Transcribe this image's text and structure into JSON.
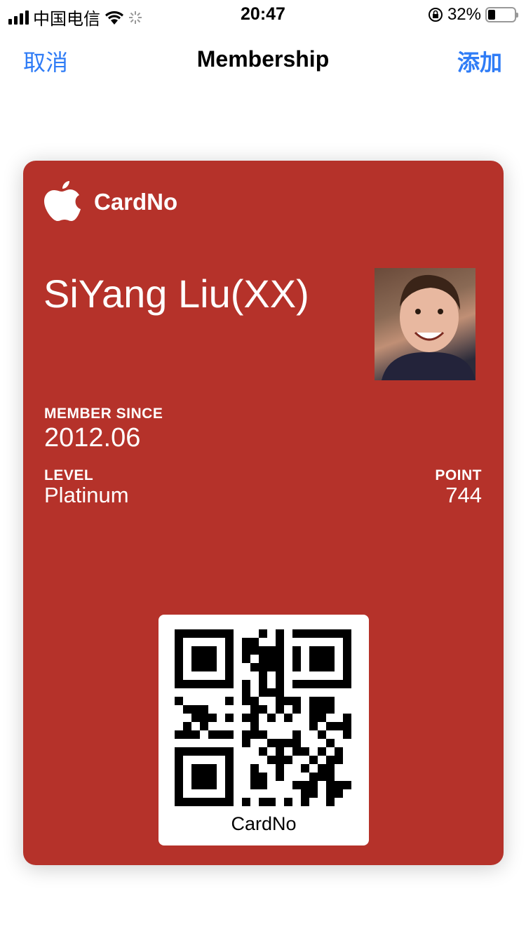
{
  "status_bar": {
    "carrier": "中国电信",
    "time": "20:47",
    "battery": "32%",
    "battery_level": 0.32
  },
  "nav": {
    "cancel": "取消",
    "title": "Membership",
    "add": "添加"
  },
  "card": {
    "brand": "CardNo",
    "name": "SiYang Liu(XX)",
    "member_since_label": "MEMBER SINCE",
    "member_since": "2012.06",
    "level_label": "LEVEL",
    "level": "Platinum",
    "point_label": "POINT",
    "point": "744",
    "qr_label": "CardNo",
    "background_color": "#b5322a"
  }
}
